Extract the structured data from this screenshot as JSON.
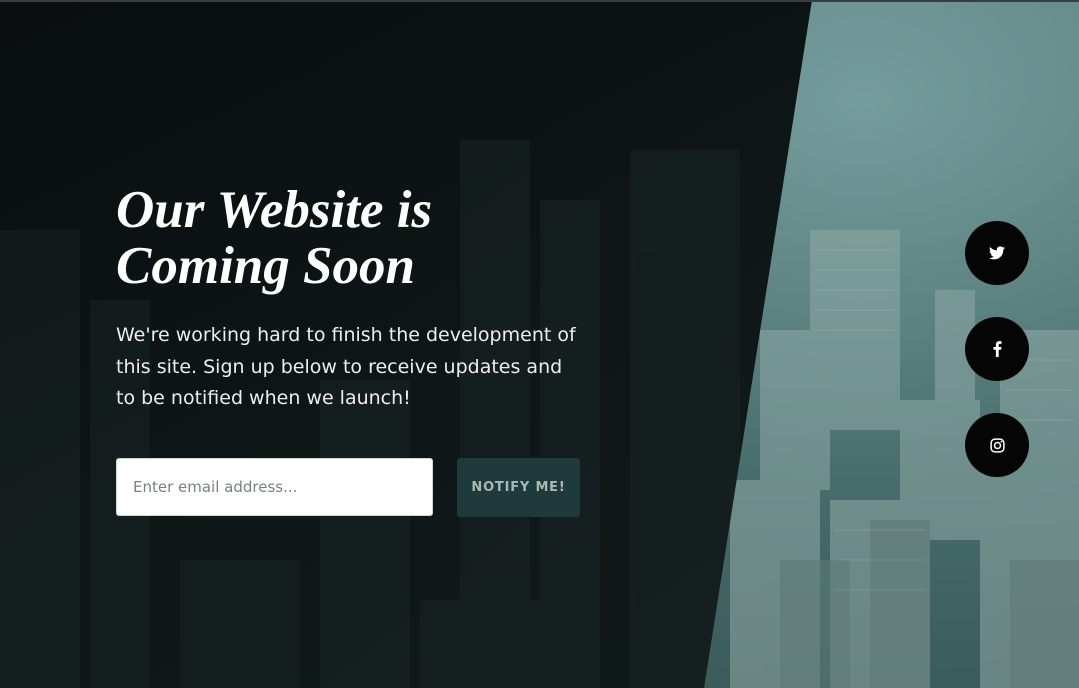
{
  "hero": {
    "title_line1": "Our Website is",
    "title_line2": "Coming Soon",
    "description": "We're working hard to finish the development of this site. Sign up below to receive updates and to be notified when we launch!"
  },
  "signup": {
    "email_placeholder": "Enter email address...",
    "email_value": "",
    "button_label": "NOTIFY ME!"
  },
  "social": [
    {
      "icon": "twitter-icon"
    },
    {
      "icon": "facebook-icon"
    },
    {
      "icon": "instagram-icon"
    }
  ],
  "colors": {
    "overlay": "#0b1011",
    "button_bg": "#1f3a3a",
    "button_text": "#a8b8b7",
    "social_bg": "#050505",
    "city_tint": "#5b7c7b"
  }
}
